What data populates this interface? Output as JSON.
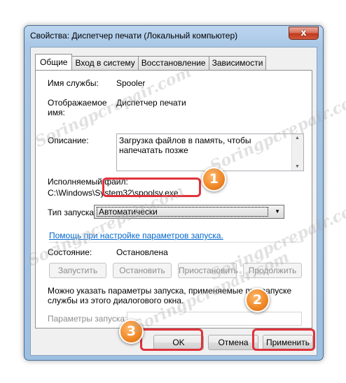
{
  "window": {
    "title": "Свойства: Диспетчер печати (Локальный компьютер)",
    "close_glyph": "x"
  },
  "tabs": [
    {
      "label": "Общие"
    },
    {
      "label": "Вход в систему"
    },
    {
      "label": "Восстановление"
    },
    {
      "label": "Зависимости"
    }
  ],
  "general": {
    "service_name_label": "Имя службы:",
    "service_name_value": "Spooler",
    "display_name_label_1": "Отображаемое",
    "display_name_label_2": "имя:",
    "display_name_value": "Диспетчер печати",
    "description_label": "Описание:",
    "description_value": "Загрузка файлов в память, чтобы напечатать позже",
    "exe_label": "Исполняемый файл:",
    "exe_path": "C:\\Windows\\System32\\spoolsv.exe",
    "startup_type_label": "Тип запуска:",
    "startup_type_value": "Автоматически",
    "help_link": "Помощь при настройке параметров запуска.",
    "state_label": "Состояние:",
    "state_value": "Остановлена",
    "start_button": "Запустить",
    "stop_button": "Остановить",
    "pause_button": "Приостановить",
    "resume_button": "Продолжить",
    "hint_line_1": "Можно указать параметры запуска, применяемые при запуске",
    "hint_line_2": "службы из этого диалогового окна.",
    "params_label": "Параметры запуска:",
    "params_value": ""
  },
  "footer": {
    "ok": "OK",
    "cancel": "Отмена",
    "apply": "Применить"
  },
  "annotations": {
    "badge_1": "1",
    "badge_2": "2",
    "badge_3": "3",
    "highlight_color": "#e1323a",
    "badge_color": "#f08a2a"
  },
  "watermark": "Soringpcrepair.com"
}
